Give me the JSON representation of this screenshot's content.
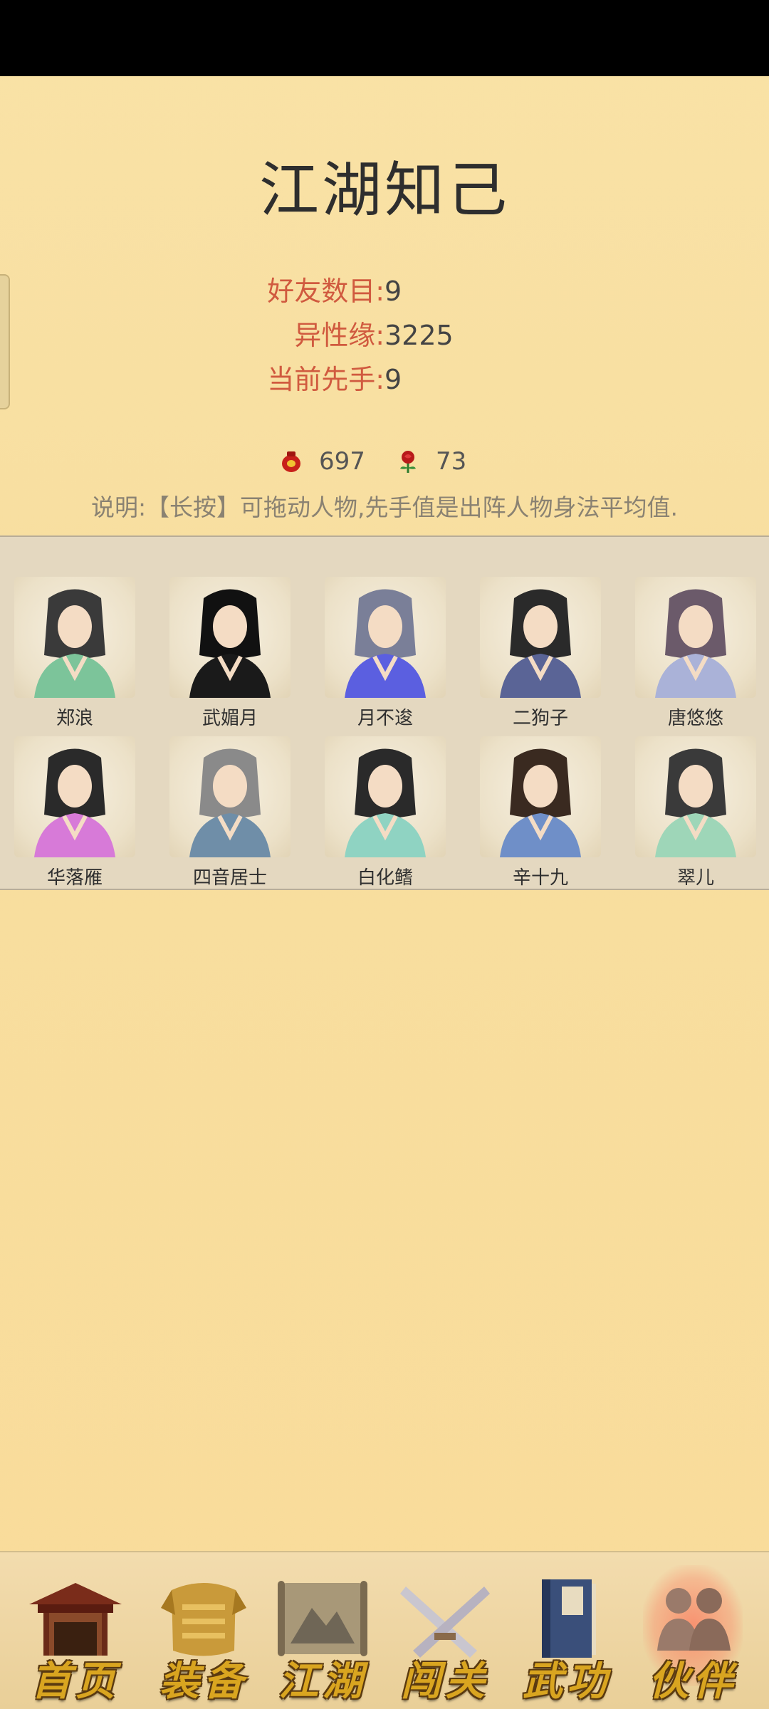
{
  "page": {
    "title": "江湖知己"
  },
  "stats": [
    {
      "label": "好友数目:",
      "value": "9"
    },
    {
      "label": "异性缘:",
      "value": "3225"
    },
    {
      "label": "当前先手:",
      "value": "9"
    }
  ],
  "currency": {
    "wine": {
      "icon": "wine-jar-icon",
      "amount": "697",
      "color": "#c8201a"
    },
    "rose": {
      "icon": "rose-icon",
      "amount": "73",
      "color": "#b81a1a"
    }
  },
  "note": "说明:【长按】可拖动人物,先手值是出阵人物身法平均值.",
  "companions": [
    {
      "name": "郑浪",
      "robe": "#7cc49a",
      "hair": "#3a3a3a"
    },
    {
      "name": "武媚月",
      "robe": "#1a1a1a",
      "hair": "#111111"
    },
    {
      "name": "月不逡",
      "robe": "#5b5fe0",
      "hair": "#7a7f98"
    },
    {
      "name": "二狗子",
      "robe": "#5a6496",
      "hair": "#2a2a2a"
    },
    {
      "name": "唐悠悠",
      "robe": "#aab2d8",
      "hair": "#6b5a6a"
    },
    {
      "name": "华落雁",
      "robe": "#d77ad8",
      "hair": "#2a2a2a"
    },
    {
      "name": "四音居士",
      "robe": "#6f8ea8",
      "hair": "#8a8a8a"
    },
    {
      "name": "白化鳍",
      "robe": "#8fd3c2",
      "hair": "#2a2a2a"
    },
    {
      "name": "辛十九",
      "robe": "#6f8fc8",
      "hair": "#3a2a20"
    },
    {
      "name": "翠儿",
      "robe": "#9ed6b8",
      "hair": "#3a3a3a"
    }
  ],
  "nav": [
    {
      "label": "首页",
      "icon": "temple-gate-icon",
      "active": false
    },
    {
      "label": "装备",
      "icon": "armor-icon",
      "active": false
    },
    {
      "label": "江湖",
      "icon": "scroll-map-icon",
      "active": false
    },
    {
      "label": "闯关",
      "icon": "crossed-swords-icon",
      "active": false
    },
    {
      "label": "武功",
      "icon": "martial-book-icon",
      "active": false
    },
    {
      "label": "伙伴",
      "icon": "companions-icon",
      "active": true
    }
  ]
}
